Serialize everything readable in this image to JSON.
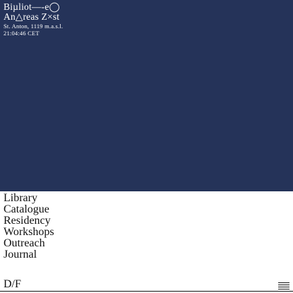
{
  "brand": {
    "line1": "Biµliot—-e◯",
    "line2": "An△reas Z×st",
    "location": "St. Anton, 1119 m.a.s.l.",
    "time": "21:04:46 CET"
  },
  "nav": {
    "items": [
      {
        "label": "Library"
      },
      {
        "label": "Catalogue"
      },
      {
        "label": "Residency"
      },
      {
        "label": "Workshops"
      },
      {
        "label": "Outreach"
      },
      {
        "label": "Journal"
      }
    ]
  },
  "footer": {
    "logo": "D/F",
    "menu_icon": "hamburger-menu-icon"
  },
  "colors": {
    "hero_background": "#253359",
    "page_background": "#ffffff",
    "text": "#111111"
  }
}
